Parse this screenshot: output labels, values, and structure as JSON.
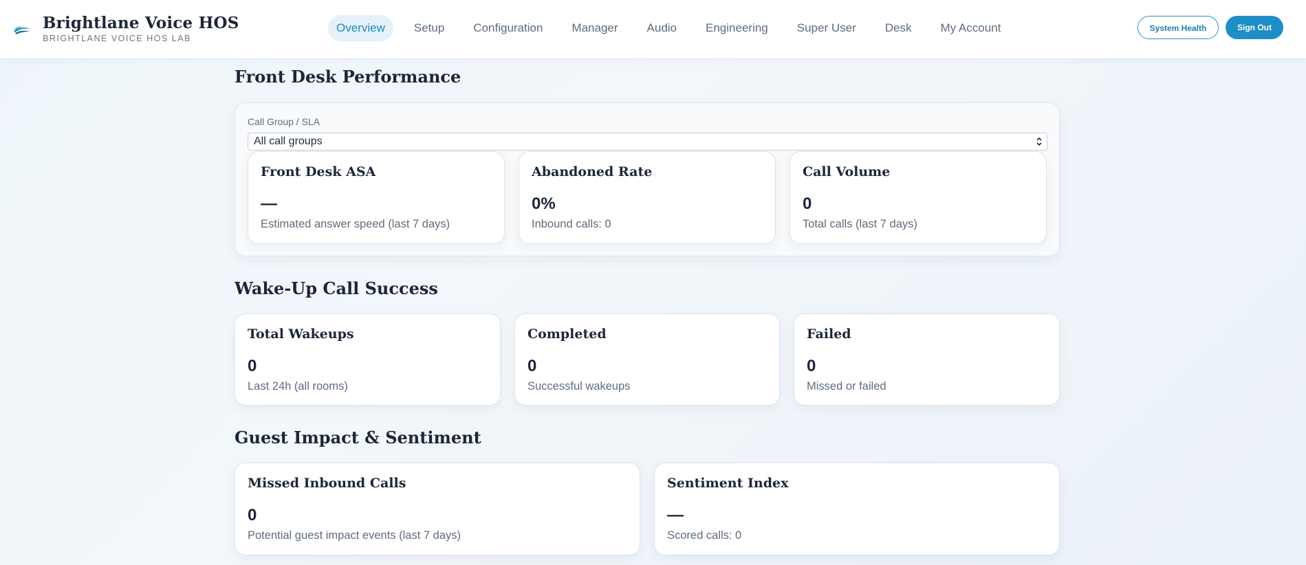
{
  "header": {
    "brand_title": "Brightlane Voice HOS",
    "brand_subtitle": "BRIGHTLANE VOICE HOS LAB",
    "logo_icon": "brightlane-swoosh-logo",
    "nav": [
      {
        "label": "Overview",
        "active": true
      },
      {
        "label": "Setup"
      },
      {
        "label": "Configuration"
      },
      {
        "label": "Manager"
      },
      {
        "label": "Audio"
      },
      {
        "label": "Engineering"
      },
      {
        "label": "Super User"
      },
      {
        "label": "Desk"
      },
      {
        "label": "My Account"
      }
    ],
    "system_health_label": "System Health",
    "sign_out_label": "Sign Out"
  },
  "front_desk": {
    "title": "Front Desk Performance",
    "filter_label": "Call Group / SLA",
    "filter_value": "All call groups",
    "cards": [
      {
        "title": "Front Desk ASA",
        "value": "—",
        "desc": "Estimated answer speed (last 7 days)"
      },
      {
        "title": "Abandoned Rate",
        "value": "0%",
        "desc": "Inbound calls: 0"
      },
      {
        "title": "Call Volume",
        "value": "0",
        "desc": "Total calls (last 7 days)"
      }
    ]
  },
  "wakeup": {
    "title": "Wake-Up Call Success",
    "cards": [
      {
        "title": "Total Wakeups",
        "value": "0",
        "desc": "Last 24h (all rooms)"
      },
      {
        "title": "Completed",
        "value": "0",
        "desc": "Successful wakeups"
      },
      {
        "title": "Failed",
        "value": "0",
        "desc": "Missed or failed"
      }
    ]
  },
  "guest_impact": {
    "title": "Guest Impact & Sentiment",
    "cards": [
      {
        "title": "Missed Inbound Calls",
        "value": "0",
        "desc": "Potential guest impact events (last 7 days)"
      },
      {
        "title": "Sentiment Index",
        "value": "—",
        "desc": "Scored calls: 0"
      }
    ]
  },
  "colors": {
    "accent": "#1d8ec6",
    "nav_active_bg": "#e4f1f9",
    "heading": "#1c2638",
    "muted": "#5f6c7d"
  }
}
